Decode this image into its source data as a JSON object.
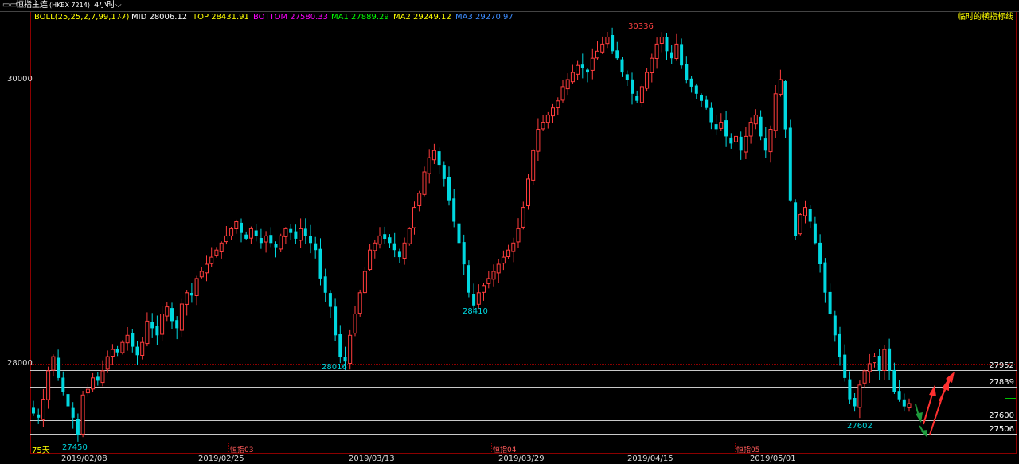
{
  "window": {
    "title": "恒指主连",
    "code": "(HKEX 7214)",
    "period": "4小时",
    "period_chevron": "chevron-down-icon"
  },
  "indicators": {
    "boll": "BOLL(25,25,2,7,99,177)",
    "mid": "MID 28006.12",
    "top": "TOP 28431.91",
    "bottom": "BOTTOM 27580.33",
    "ma1": "MA1 27889.29",
    "ma2": "MA2 29249.12",
    "ma3": "MA3 29270.97",
    "right_label": "临时的横指标线",
    "colors": {
      "boll": "#ffff00",
      "mid": "#ffffff",
      "top": "#ffff00",
      "bottom": "#ff00ff",
      "ma1": "#00ff00",
      "ma2": "#ffff00",
      "ma3": "#3c8cff"
    }
  },
  "axis": {
    "price_labels": [
      "30000",
      "28000"
    ],
    "date_labels": [
      "2019/02/08",
      "2019/02/25",
      "2019/03/13",
      "2019/03/29",
      "2019/04/15",
      "2019/05/01"
    ],
    "month_labels": [
      "恒指03",
      "恒指04",
      "恒指05"
    ],
    "day_count": "75天"
  },
  "levels": {
    "l27952": "27952",
    "l27839": "27839",
    "l27600": "27600",
    "l27506": "27506"
  },
  "annotations": {
    "high": "30336",
    "low1": "27450",
    "low2": "28016",
    "low3": "28410",
    "low4": "27602"
  },
  "colors": {
    "up": "#ff3c3c",
    "down": "#00d8e0",
    "grid": "#8b0000",
    "hline": "#c8c8c8",
    "background": "#000000"
  },
  "chart_data": {
    "type": "candlestick",
    "ylim": [
      27450,
      30336
    ],
    "levels": [
      27952,
      27839,
      27600,
      27506
    ],
    "closes": [
      27650,
      27620,
      27750,
      27950,
      28050,
      27900,
      27800,
      27700,
      27620,
      27500,
      27780,
      27820,
      27900,
      27880,
      27950,
      28050,
      28100,
      28080,
      28150,
      28200,
      28120,
      28060,
      28150,
      28300,
      28250,
      28200,
      28350,
      28400,
      28300,
      28250,
      28420,
      28500,
      28480,
      28600,
      28650,
      28700,
      28750,
      28800,
      28850,
      28900,
      28950,
      29000,
      28920,
      28880,
      28950,
      28900,
      28850,
      28900,
      28850,
      28820,
      28900,
      28950,
      28920,
      28880,
      28950,
      28900,
      28850,
      28800,
      28600,
      28500,
      28400,
      28200,
      28050,
      28016,
      28200,
      28350,
      28500,
      28650,
      28800,
      28850,
      28900,
      28880,
      28850,
      28800,
      28750,
      28850,
      28950,
      29100,
      29200,
      29350,
      29450,
      29500,
      29400,
      29300,
      29150,
      29000,
      28850,
      28700,
      28500,
      28410,
      28500,
      28550,
      28600,
      28650,
      28700,
      28750,
      28800,
      28850,
      28950,
      29100,
      29300,
      29500,
      29650,
      29700,
      29750,
      29800,
      29850,
      29950,
      30000,
      30050,
      30100,
      30080,
      30050,
      30150,
      30200,
      30250,
      30300,
      30200,
      30150,
      30050,
      30000,
      29900,
      29850,
      29950,
      30050,
      30150,
      30250,
      30300,
      30200,
      30150,
      30250,
      30100,
      30000,
      29950,
      29900,
      29850,
      29800,
      29700,
      29650,
      29700,
      29600,
      29550,
      29600,
      29500,
      29600,
      29700,
      29750,
      29600,
      29500,
      29650,
      29900,
      30000,
      29650,
      29150,
      28900,
      29050,
      29100,
      29000,
      28850,
      28700,
      28500,
      28350,
      28200,
      28050,
      27900,
      27750,
      27700,
      27850,
      27950,
      28000,
      28050,
      27950,
      28100,
      27950,
      27800,
      27750,
      27700,
      27720
    ]
  }
}
